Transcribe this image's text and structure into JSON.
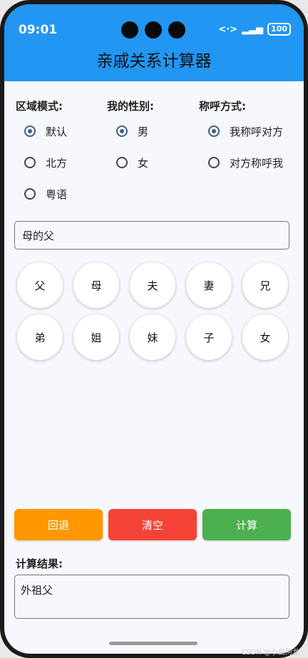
{
  "status": {
    "time": "09:01",
    "battery": "100"
  },
  "app": {
    "title": "亲戚关系计算器"
  },
  "region": {
    "title": "区域模式:",
    "options": [
      {
        "label": "默认",
        "checked": true
      },
      {
        "label": "北方",
        "checked": false
      },
      {
        "label": "粤语",
        "checked": false
      }
    ]
  },
  "gender": {
    "title": "我的性别:",
    "options": [
      {
        "label": "男",
        "checked": true
      },
      {
        "label": "女",
        "checked": false
      }
    ]
  },
  "address": {
    "title": "称呼方式:",
    "options": [
      {
        "label": "我称呼对方",
        "checked": true
      },
      {
        "label": "对方称呼我",
        "checked": false
      }
    ]
  },
  "input": {
    "value": "母的父"
  },
  "keys": [
    "父",
    "母",
    "夫",
    "妻",
    "兄",
    "弟",
    "姐",
    "妹",
    "子",
    "女"
  ],
  "actions": {
    "back": "回退",
    "clear": "清空",
    "calc": "计算"
  },
  "result": {
    "title": "计算结果:",
    "value": "外祖父"
  },
  "watermark": "CSDN @小白阿龙",
  "colors": {
    "primary": "#2196f3",
    "back": "#ff9800",
    "clear": "#f44336",
    "calc": "#4caf50"
  }
}
